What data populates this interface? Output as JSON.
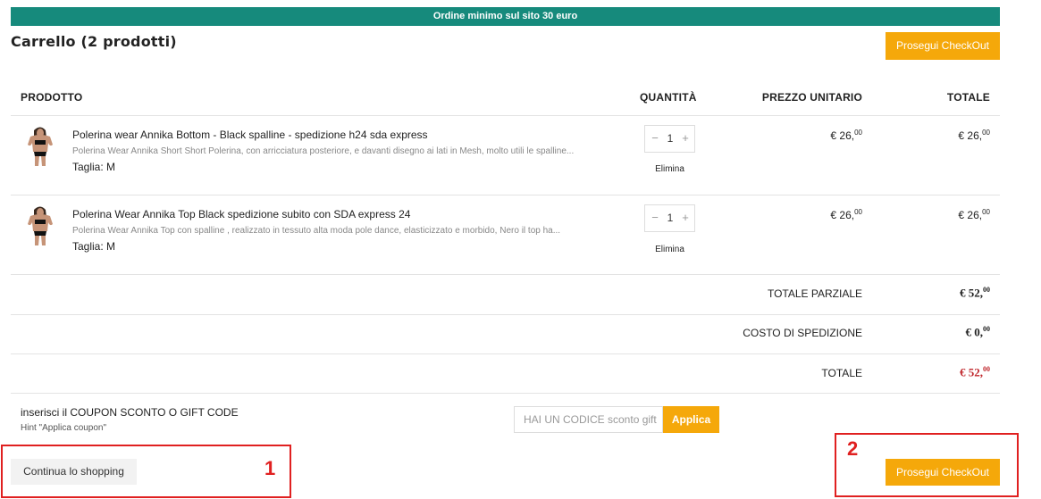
{
  "banner": {
    "text": "Ordine minimo sul sito 30 euro"
  },
  "header": {
    "title": "Carrello (2 prodotti)",
    "checkout_label": "Prosegui CheckOut"
  },
  "table": {
    "columns": [
      "PRODOTTO",
      "QUANTITÀ",
      "PREZZO UNITARIO",
      "TOTALE"
    ],
    "rows": [
      {
        "name": "Polerina wear Annika Bottom - Black spalline - spedizione h24 sda express",
        "description": "Polerina Wear Annika Short Short Polerina, con arricciatura posteriore, e davanti disegno ai lati in Mesh, molto utili le spalline...",
        "size_label": "Taglia",
        "size_value": "M",
        "qty": "1",
        "remove_label": "Elimina",
        "unit_price": "€ 26,",
        "unit_price_cents": "00",
        "total": "€ 26,",
        "total_cents": "00"
      },
      {
        "name": "Polerina Wear Annika Top Black spedizione subito con SDA express 24",
        "description": "Polerina Wear Annika Top con spalline , realizzato in tessuto alta moda pole dance, elasticizzato e morbido, Nero il top ha...",
        "size_label": "Taglia",
        "size_value": "M",
        "qty": "1",
        "remove_label": "Elimina",
        "unit_price": "€ 26,",
        "unit_price_cents": "00",
        "total": "€ 26,",
        "total_cents": "00"
      }
    ]
  },
  "summary": {
    "subtotal_label": "TOTALE PARZIALE",
    "subtotal": "€ 52,",
    "subtotal_cents": "00",
    "shipping_label": "COSTO DI SPEDIZIONE",
    "shipping": "€ 0,",
    "shipping_cents": "00",
    "total_label": "TOTALE",
    "total": "€ 52,",
    "total_cents": "00"
  },
  "coupon": {
    "label": "inserisci il COUPON SCONTO O GIFT CODE",
    "hint": "Hint \"Applica coupon\"",
    "placeholder": "HAI UN CODICE sconto gift",
    "apply_label": "Applica"
  },
  "footer": {
    "continue_label": "Continua lo shopping",
    "checkout_label": "Prosegui CheckOut"
  },
  "annotations": {
    "box1": "1",
    "box2": "2"
  },
  "colors": {
    "banner": "#168a7c",
    "accent": "#f5a80a",
    "total_red": "#c0282d",
    "annotation": "#e02020"
  }
}
